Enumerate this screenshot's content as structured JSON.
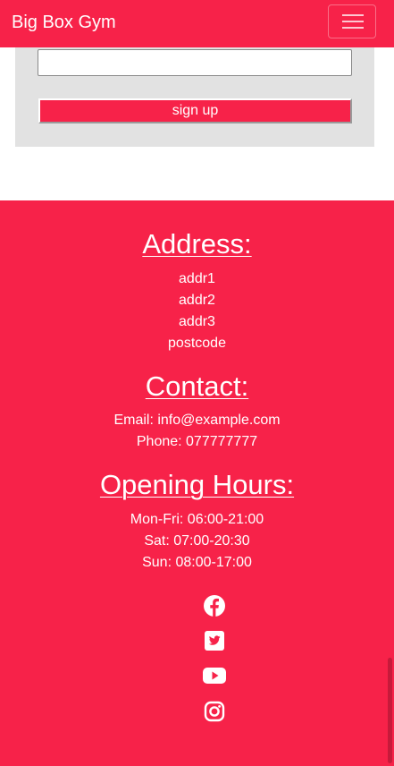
{
  "navbar": {
    "brand": "Big Box Gym",
    "menu_icon": "hamburger-menu-icon",
    "background_color": "#f72249"
  },
  "signup_form": {
    "email_input_value": "",
    "submit_label": "sign up",
    "panel_color": "#e2e2e2"
  },
  "footer": {
    "background_color": "#f72249",
    "address": {
      "heading": "Address:",
      "lines": [
        "addr1",
        "addr2",
        "addr3",
        "postcode"
      ]
    },
    "contact": {
      "heading": "Contact:",
      "email": "Email: info@example.com",
      "phone": "Phone: 077777777"
    },
    "opening_hours": {
      "heading": "Opening Hours:",
      "lines": [
        "Mon-Fri: 06:00-21:00",
        "Sat: 07:00-20:30",
        "Sun: 08:00-17:00"
      ]
    },
    "social_icons": [
      "facebook-icon",
      "twitter-icon",
      "youtube-icon",
      "instagram-icon"
    ]
  }
}
